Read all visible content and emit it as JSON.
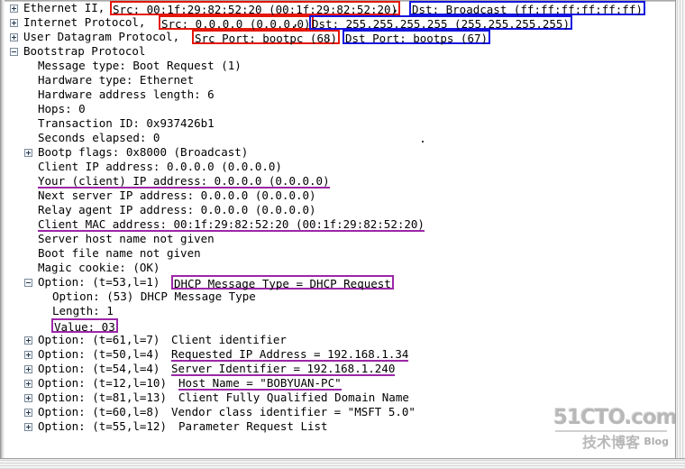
{
  "window": {
    "pane": "packet-details",
    "vertical_scrollbar": true,
    "horizontal_scrollbar": true
  },
  "colors": {
    "source_highlight": "#e4170b",
    "destination_highlight": "#1414e0",
    "dhcp_highlight": "#9c26a8",
    "text": "#000000",
    "background": "#ffffff"
  },
  "protocol_rows": {
    "ethernet": {
      "prefix": "Ethernet II, ",
      "src": "Src: 00:1f:29:82:52:20 (00:1f:29:82:52:20)",
      "separator": ", ",
      "dst": "Dst: Broadcast (ff:ff:ff:ff:ff:ff)"
    },
    "ip": {
      "prefix": "Internet Protocol, ",
      "src": "Src: 0.0.0.0 (0.0.0.0)",
      "separator": ", ",
      "dst": "Dst: 255.255.255.255 (255.255.255.255)"
    },
    "udp": {
      "prefix": "User Datagram Protocol, ",
      "src": "Src Port: bootpc (68)",
      "separator": ", ",
      "dst": "Dst Port: bootps (67)"
    },
    "bootp": {
      "label": "Bootstrap Protocol"
    }
  },
  "bootp_fields": [
    {
      "text": "Message type: Boot Request (1)"
    },
    {
      "text": "Hardware type: Ethernet"
    },
    {
      "text": "Hardware address length: 6"
    },
    {
      "text": "Hops: 0"
    },
    {
      "text": "Transaction ID: 0x937426b1"
    },
    {
      "text": "Seconds elapsed: 0"
    },
    {
      "text": "Bootp flags: 0x8000 (Broadcast)"
    },
    {
      "text": "Client IP address: 0.0.0.0 (0.0.0.0)"
    },
    {
      "text": "Your (client) IP address: 0.0.0.0 (0.0.0.0)"
    },
    {
      "text": "Next server IP address: 0.0.0.0 (0.0.0.0)"
    },
    {
      "text": "Relay agent IP address: 0.0.0.0 (0.0.0.0)"
    },
    {
      "text": "Client MAC address: 00:1f:29:82:52:20 (00:1f:29:82:52:20)"
    },
    {
      "text": "Server host name not given"
    },
    {
      "text": "Boot file name not given"
    },
    {
      "text": "Magic cookie: (OK)"
    }
  ],
  "dhcp_option_53": {
    "header_prefix": "Option: (t=53,l=1) ",
    "header_value": "DHCP Message Type = DHCP Request",
    "sub_option": "Option: (53) DHCP Message Type",
    "sub_length": "Length: 1",
    "sub_value": "Value: 03"
  },
  "options": [
    {
      "prefix": "Option: (t=61,l=7) ",
      "value": "Client identifier",
      "underlined": false
    },
    {
      "prefix": "Option: (t=50,l=4) ",
      "value": "Requested IP Address = 192.168.1.34",
      "underlined": true
    },
    {
      "prefix": "Option: (t=54,l=4) ",
      "value": "Server Identifier = 192.168.1.240",
      "underlined": true
    },
    {
      "prefix": "Option: (t=12,l=10) ",
      "value": "Host Name = \"BOBYUAN-PC\"",
      "underlined": true
    },
    {
      "prefix": "Option: (t=81,l=13) ",
      "value": "Client Fully Qualified Domain Name",
      "underlined": false
    },
    {
      "prefix": "Option: (t=60,l=8) ",
      "value": "Vendor class identifier = \"MSFT 5.0\"",
      "underlined": false
    },
    {
      "prefix": "Option: (t=55,l=12) ",
      "value": "Parameter Request List",
      "underlined": false
    }
  ],
  "watermark": {
    "site": "51CTO.com",
    "tagline": "技术博客",
    "blog": "Blog"
  }
}
